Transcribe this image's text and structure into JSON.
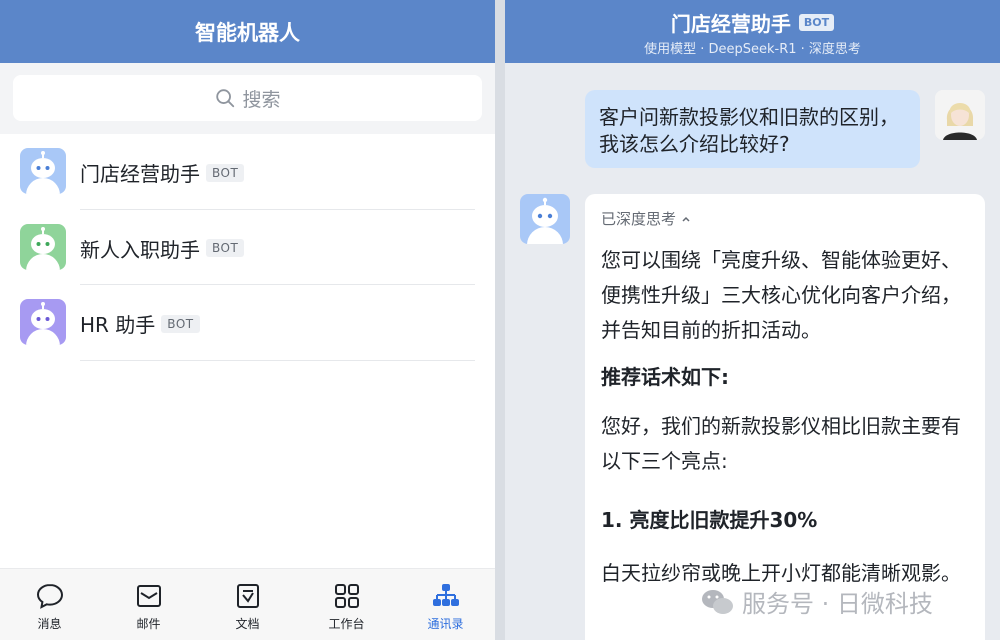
{
  "left": {
    "title": "智能机器人",
    "search_placeholder": "搜索",
    "bots": [
      {
        "name": "门店经营助手",
        "badge": "BOT",
        "color": "#8ab4f8"
      },
      {
        "name": "新人入职助手",
        "badge": "BOT",
        "color": "#7fd08c"
      },
      {
        "name": "HR 助手",
        "badge": "BOT",
        "color": "#9b8cf0"
      }
    ],
    "tabs": [
      {
        "label": "消息",
        "icon": "chat-bubble-icon"
      },
      {
        "label": "邮件",
        "icon": "mail-icon"
      },
      {
        "label": "文档",
        "icon": "document-icon"
      },
      {
        "label": "工作台",
        "icon": "grid-apps-icon"
      },
      {
        "label": "通讯录",
        "icon": "contacts-org-icon",
        "active": true
      }
    ]
  },
  "right": {
    "title": "门店经营助手",
    "badge": "BOT",
    "subtitle": "使用模型 · DeepSeek-R1 · 深度思考",
    "user_message": "客户问新款投影仪和旧款的区别，我该怎么介绍比较好?",
    "thinking_label": "已深度思考",
    "reply": {
      "intro": "您可以围绕「亮度升级、智能体验更好、便携性升级」三大核心优化向客户介绍，并告知目前的折扣活动。",
      "heading": "推荐话术如下:",
      "para": "您好，我们的新款投影仪相比旧款主要有以下三个亮点:",
      "point1_title": "1.  亮度比旧款提升30%",
      "point1_text": "白天拉纱帘或晚上开小灯都能清晰观影。"
    }
  },
  "watermark": "服务号 · 日微科技",
  "colors": {
    "header": "#5b86c9",
    "user_bubble": "#cfe3fb",
    "active_tab": "#2f6fde"
  }
}
